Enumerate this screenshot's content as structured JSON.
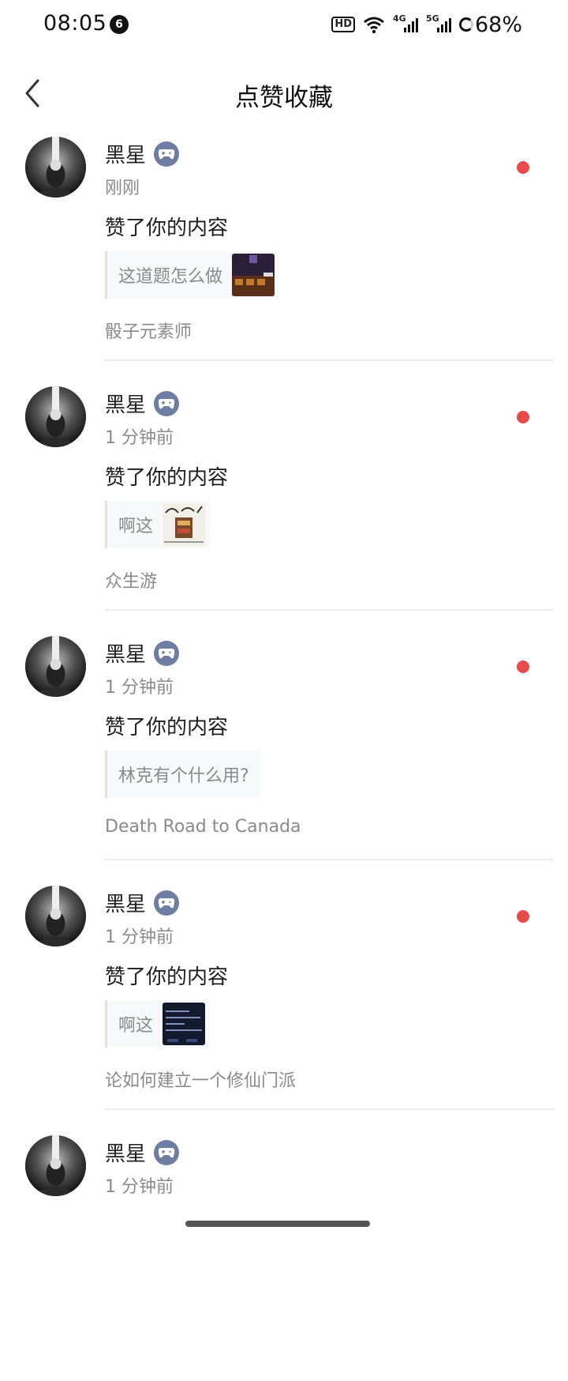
{
  "status_bar": {
    "time": "08:05",
    "notification_count": "6",
    "hd": "HD",
    "net1": "4G",
    "net2": "5G",
    "battery": "68%"
  },
  "header": {
    "title": "点赞收藏"
  },
  "notifications": [
    {
      "user": "黑星",
      "time": "刚刚",
      "action": "赞了你的内容",
      "quote": "这道题怎么做",
      "source": "骰子元素师",
      "has_thumb": true,
      "thumb_style": "game1"
    },
    {
      "user": "黑星",
      "time": "1 分钟前",
      "action": "赞了你的内容",
      "quote": "啊这",
      "source": "众生游",
      "has_thumb": true,
      "thumb_style": "game2"
    },
    {
      "user": "黑星",
      "time": "1 分钟前",
      "action": "赞了你的内容",
      "quote": "林克有个什么用?",
      "source": "Death Road to Canada",
      "has_thumb": false
    },
    {
      "user": "黑星",
      "time": "1 分钟前",
      "action": "赞了你的内容",
      "quote": "啊这",
      "source": "论如何建立一个修仙门派",
      "has_thumb": true,
      "thumb_style": "game3"
    },
    {
      "user": "黑星",
      "time": "1 分钟前",
      "action": "",
      "quote": "",
      "source": "",
      "has_thumb": false
    }
  ],
  "colors": {
    "unread_dot": "#e94b4b",
    "badge": "#6f7da3"
  }
}
